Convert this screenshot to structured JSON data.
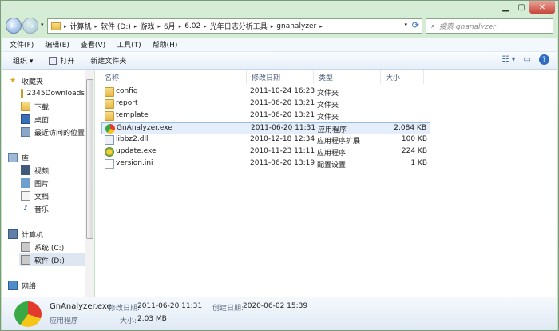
{
  "nav": {
    "back_icon": "back-arrow-icon",
    "forward_icon": "forward-arrow-icon",
    "breadcrumbs": [
      "计算机",
      "软件 (D:)",
      "游戏",
      "6月",
      "6.02",
      "光年日志分析工具",
      "gnanalyzer"
    ],
    "search_placeholder": "搜索 gnanalyzer"
  },
  "menu": [
    "文件(F)",
    "编辑(E)",
    "查看(V)",
    "工具(T)",
    "帮助(H)"
  ],
  "toolbar": {
    "organize": "组织 ▾",
    "open": "打开",
    "new_folder": "新建文件夹"
  },
  "sidebar": {
    "favorites": "收藏夹",
    "fav_items": [
      "2345Downloads",
      "下载",
      "桌面",
      "最近访问的位置"
    ],
    "libraries": "库",
    "lib_items": [
      "视频",
      "图片",
      "文档",
      "音乐"
    ],
    "computer": "计算机",
    "drives": [
      "系统 (C:)",
      "软件 (D:)"
    ],
    "network": "网络"
  },
  "columns": {
    "name": "名称",
    "date": "修改日期",
    "type": "类型",
    "size": "大小"
  },
  "files": [
    {
      "name": "config",
      "date": "2011-10-24 16:23",
      "type": "文件夹",
      "size": "",
      "icon": "folder"
    },
    {
      "name": "report",
      "date": "2011-06-20 13:21",
      "type": "文件夹",
      "size": "",
      "icon": "folder"
    },
    {
      "name": "template",
      "date": "2011-06-20 13:21",
      "type": "文件夹",
      "size": "",
      "icon": "folder"
    },
    {
      "name": "GnAnalyzer.exe",
      "date": "2011-06-20 11:31",
      "type": "应用程序",
      "size": "2,084 KB",
      "icon": "app"
    },
    {
      "name": "libbz2.dll",
      "date": "2010-12-18 12:34",
      "type": "应用程序扩展",
      "size": "100 KB",
      "icon": "dll"
    },
    {
      "name": "update.exe",
      "date": "2010-11-23 11:11",
      "type": "应用程序",
      "size": "224 KB",
      "icon": "update"
    },
    {
      "name": "version.ini",
      "date": "2011-06-20 13:19",
      "type": "配置设置",
      "size": "1 KB",
      "icon": "ini"
    }
  ],
  "details": {
    "filename": "GnAnalyzer.exe",
    "mod_label": "修改日期:",
    "mod_value": "2011-06-20 11:31",
    "created_label": "创建日期:",
    "created_value": "2020-06-02 15:39",
    "type": "应用程序",
    "size_label": "大小:",
    "size_value": "2.03 MB"
  }
}
